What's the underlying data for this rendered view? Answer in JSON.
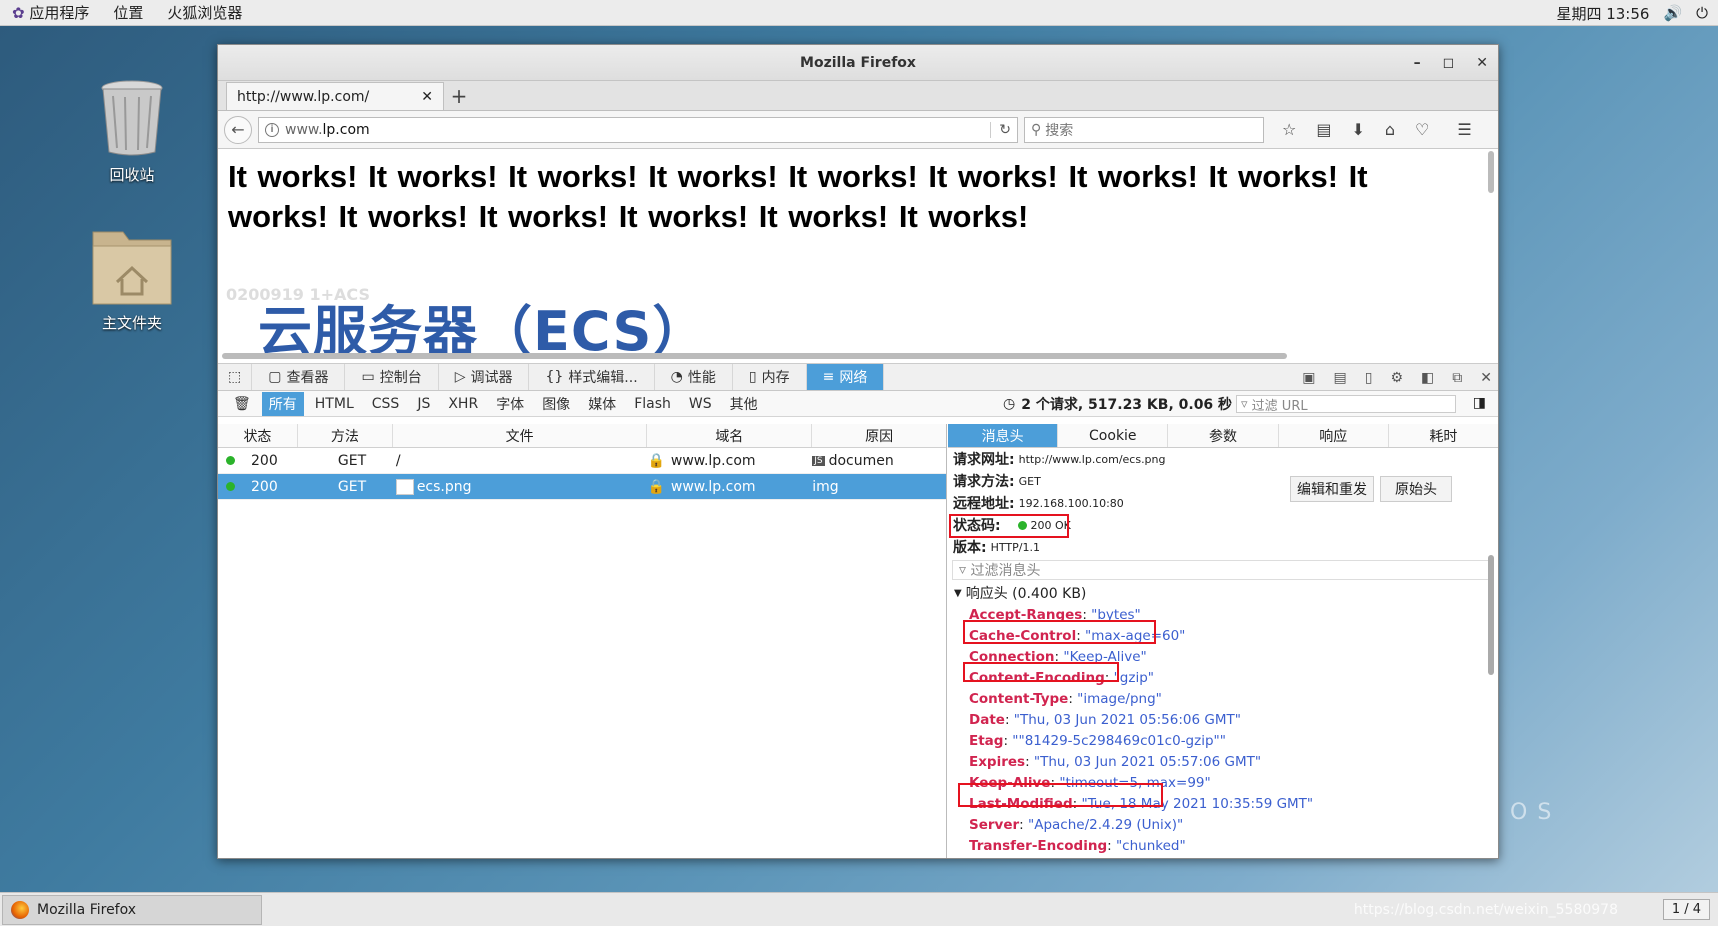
{
  "topbar": {
    "apps": "应用程序",
    "places": "位置",
    "browser": "火狐浏览器",
    "clock": "星期四 13:56"
  },
  "desktop": {
    "trash": "回收站",
    "home": "主文件夹"
  },
  "window": {
    "title": "Mozilla Firefox"
  },
  "tab": {
    "label": "http://www.lp.com/"
  },
  "nav": {
    "url_prefix": "www.",
    "url_domain": "lp.com",
    "search_placeholder": "搜索"
  },
  "page": {
    "text": "It works! It works! It works! It works! It works! It works! It works! It works! It works! It works! It works! It works! It works! It works!",
    "image_caption_small": "0200919 1+ACS",
    "image_title": "云服务器（ECS）"
  },
  "devtools": {
    "tabs": [
      "查看器",
      "控制台",
      "调试器",
      "样式编辑...",
      "性能",
      "内存",
      "网络"
    ],
    "filters": [
      "所有",
      "HTML",
      "CSS",
      "JS",
      "XHR",
      "字体",
      "图像",
      "媒体",
      "Flash",
      "WS",
      "其他"
    ],
    "summary": "2 个请求, 517.23 KB, 0.06 秒",
    "url_filter_placeholder": "过滤 URL",
    "columns": [
      "状态",
      "方法",
      "文件",
      "域名",
      "原因"
    ],
    "requests": [
      {
        "status": "200",
        "method": "GET",
        "file": "/",
        "domain": "www.lp.com",
        "cause": "documen"
      },
      {
        "status": "200",
        "method": "GET",
        "file": "ecs.png",
        "domain": "www.lp.com",
        "cause": "img"
      }
    ],
    "detail_tabs": [
      "消息头",
      "Cookie",
      "参数",
      "响应",
      "耗时"
    ],
    "request_url_label": "请求网址:",
    "request_url": "http://www.lp.com/ecs.png",
    "method_label": "请求方法:",
    "method": "GET",
    "remote_label": "远程地址:",
    "remote": "192.168.100.10:80",
    "status_label": "状态码:",
    "status": "200  OK",
    "version_label": "版本:",
    "version": "HTTP/1.1",
    "edit_resend": "编辑和重发",
    "raw_headers": "原始头",
    "header_filter_placeholder": "过滤消息头",
    "response_section": "响应头 (0.400 KB)",
    "headers": [
      {
        "name": "Accept-Ranges",
        "value": "\"bytes\""
      },
      {
        "name": "Cache-Control",
        "value": "\"max-age=60\""
      },
      {
        "name": "Connection",
        "value": "\"Keep-Alive\""
      },
      {
        "name": "Content-Encoding",
        "value": "\"gzip\""
      },
      {
        "name": "Content-Type",
        "value": "\"image/png\""
      },
      {
        "name": "Date",
        "value": "\"Thu, 03 Jun 2021 05:56:06 GMT\""
      },
      {
        "name": "Etag",
        "value": "\"\"81429-5c298469c01c0-gzip\"\""
      },
      {
        "name": "Expires",
        "value": "\"Thu, 03 Jun 2021 05:57:06 GMT\""
      },
      {
        "name": "Keep-Alive",
        "value": "\"timeout=5, max=99\""
      },
      {
        "name": "Last-Modified",
        "value": "\"Tue, 18 May 2021 10:35:59 GMT\""
      },
      {
        "name": "Server",
        "value": "\"Apache/2.4.29 (Unix)\""
      },
      {
        "name": "Transfer-Encoding",
        "value": "\"chunked\""
      }
    ]
  },
  "taskbar": {
    "item": "Mozilla Firefox",
    "pager": "1 / 4",
    "watermark": "https://blog.csdn.net/weixin_5580978"
  },
  "colors": {
    "accent": "#4c9ed9",
    "header_name": "#d1244f",
    "header_value": "#3b5fcf",
    "highlight": "#e5121f",
    "status_ok": "#2bb32b"
  }
}
